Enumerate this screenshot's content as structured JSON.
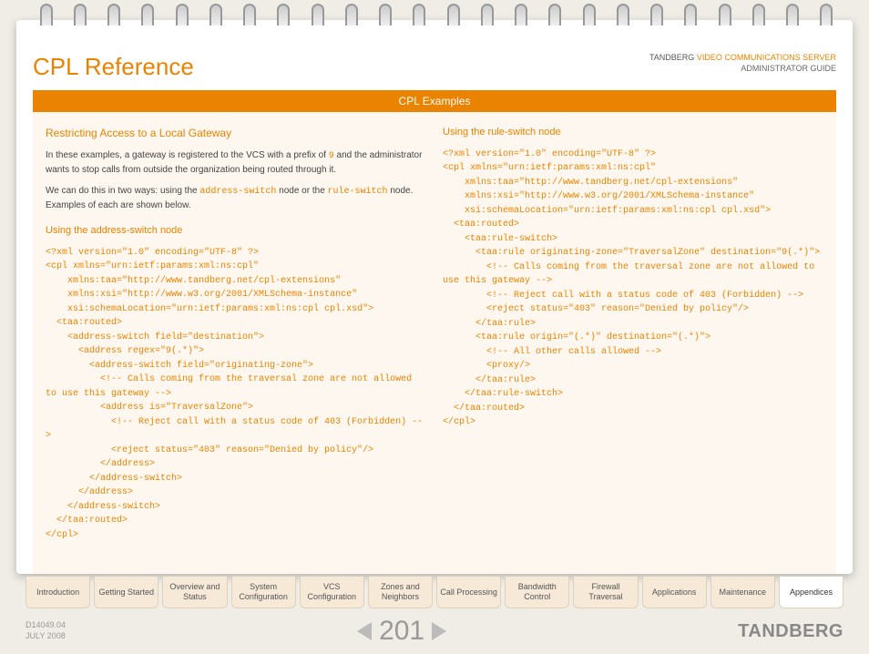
{
  "header": {
    "title": "CPL Reference",
    "brand": "TANDBERG",
    "product": "VIDEO COMMUNICATIONS SERVER",
    "guide": "ADMINISTRATOR GUIDE"
  },
  "section_bar": "CPL Examples",
  "left": {
    "subhead": "Restricting Access to a Local Gateway",
    "para1_a": "In these examples, a gateway is registered to the VCS with a prefix of ",
    "para1_code": "9",
    "para1_b": " and the administrator wants to stop calls from outside the organization being routed through it.",
    "para2_a": "We can do this in two ways: using the ",
    "para2_code1": "address-switch",
    "para2_mid": " node or the ",
    "para2_code2": "rule-switch",
    "para2_b": " node. Examples of each are shown below.",
    "subhead2": "Using the address-switch node",
    "code": "<?xml version=\"1.0\" encoding=\"UTF-8\" ?>\n<cpl xmlns=\"urn:ietf:params:xml:ns:cpl\"\n    xmlns:taa=\"http://www.tandberg.net/cpl-extensions\"\n    xmlns:xsi=\"http://www.w3.org/2001/XMLSchema-instance\"\n    xsi:schemaLocation=\"urn:ietf:params:xml:ns:cpl cpl.xsd\">\n  <taa:routed>\n    <address-switch field=\"destination\">\n      <address regex=\"9(.*)\">\n        <address-switch field=\"originating-zone\">\n          <!-- Calls coming from the traversal zone are not allowed to use this gateway -->\n          <address is=\"TraversalZone\">\n            <!-- Reject call with a status code of 403 (Forbidden) -->\n            <reject status=\"403\" reason=\"Denied by policy\"/>\n          </address>\n        </address-switch>\n      </address>\n    </address-switch>\n  </taa:routed>\n</cpl>"
  },
  "right": {
    "subhead2": "Using the rule-switch node",
    "code": "<?xml version=\"1.0\" encoding=\"UTF-8\" ?>\n<cpl xmlns=\"urn:ietf:params:xml:ns:cpl\"\n    xmlns:taa=\"http://www.tandberg.net/cpl-extensions\"\n    xmlns:xsi=\"http://www.w3.org/2001/XMLSchema-instance\"\n    xsi:schemaLocation=\"urn:ietf:params:xml:ns:cpl cpl.xsd\">\n  <taa:routed>\n    <taa:rule-switch>\n      <taa:rule originating-zone=\"TraversalZone\" destination=\"9(.*)\">\n        <!-- Calls coming from the traversal zone are not allowed to use this gateway -->\n        <!-- Reject call with a status code of 403 (Forbidden) -->\n        <reject status=\"403\" reason=\"Denied by policy\"/>\n      </taa:rule>\n      <taa:rule origin=\"(.*)\" destination=\"(.*)\">\n        <!-- All other calls allowed -->\n        <proxy/>\n      </taa:rule>\n    </taa:rule-switch>\n  </taa:routed>\n</cpl>"
  },
  "tabs": [
    "Introduction",
    "Getting Started",
    "Overview and Status",
    "System Configuration",
    "VCS Configuration",
    "Zones and Neighbors",
    "Call Processing",
    "Bandwidth Control",
    "Firewall Traversal",
    "Applications",
    "Maintenance",
    "Appendices"
  ],
  "active_tab_index": 11,
  "footer": {
    "doc_id": "D14049.04",
    "date": "JULY 2008",
    "page_number": "201",
    "brand": "TANDBERG"
  }
}
